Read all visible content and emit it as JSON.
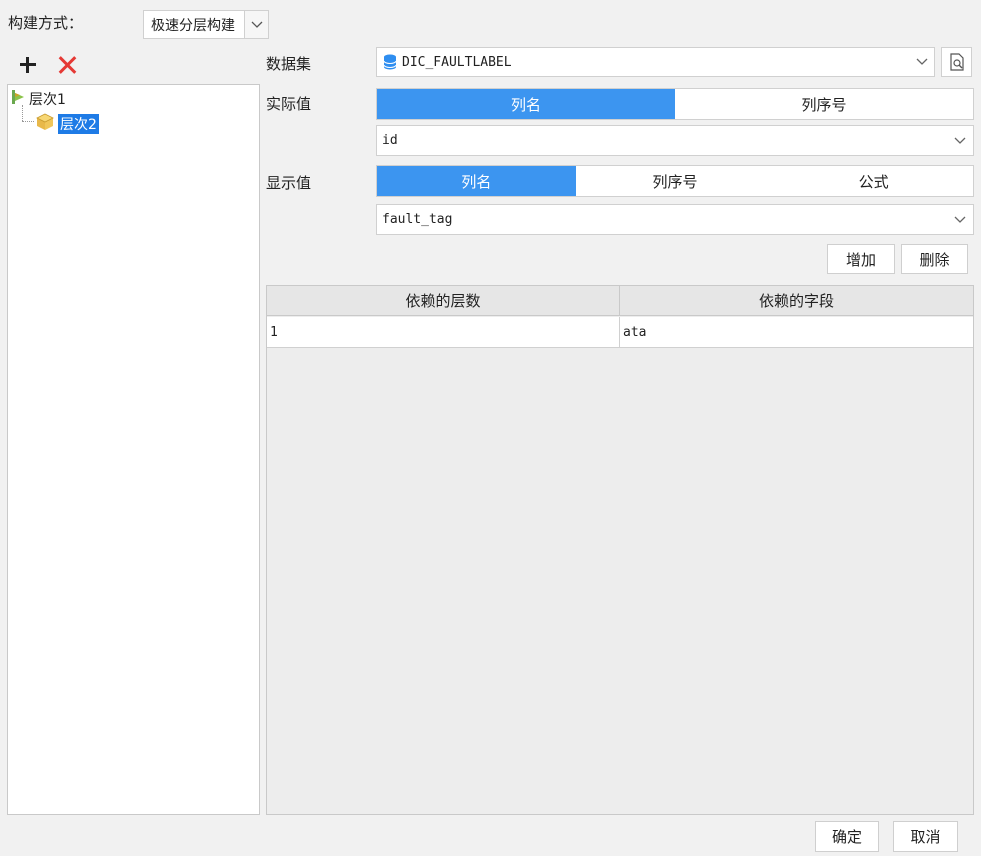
{
  "build": {
    "label": "构建方式：",
    "value": "极速分层构建"
  },
  "tree": {
    "nodes": [
      {
        "label": "层次1"
      },
      {
        "label": "层次2"
      }
    ]
  },
  "form": {
    "dataset_label": "数据集",
    "dataset_value": "DIC_FAULTLABEL",
    "actual_label": "实际值",
    "actual_options": [
      "列名",
      "列序号"
    ],
    "actual_selected": "列名",
    "actual_value": "id",
    "display_label": "显示值",
    "display_options": [
      "列名",
      "列序号",
      "公式"
    ],
    "display_selected": "列名",
    "display_value": "fault_tag",
    "add_label": "增加",
    "delete_label": "删除"
  },
  "table": {
    "headers": [
      "依赖的层数",
      "依赖的字段"
    ],
    "rows": [
      [
        "1",
        "ata"
      ]
    ]
  },
  "footer": {
    "ok_label": "确定",
    "cancel_label": "取消"
  },
  "colors": {
    "accent": "#3c95f0",
    "selection": "#1e7be6",
    "delete_red": "#e53935"
  }
}
